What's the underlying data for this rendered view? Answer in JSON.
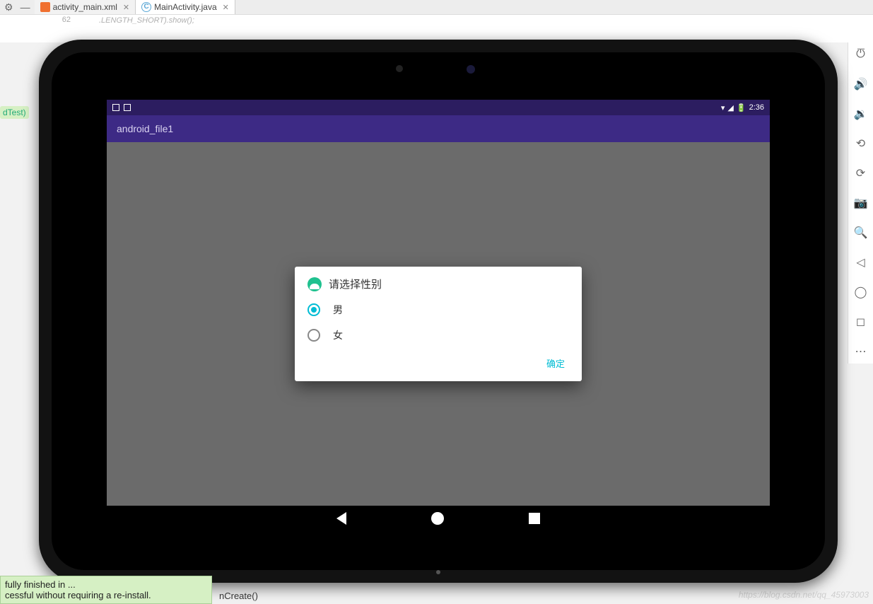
{
  "ide": {
    "tab1": "activity_main.xml",
    "tab2": "MainActivity.java",
    "gutter_line": "62",
    "code_fragment": ".LENGTH_SHORT).show();",
    "dtest": "dTest)",
    "success_line1": "fully finished in ...",
    "success_line2": "cessful without requiring a re-install.",
    "oncreate": "nCreate()"
  },
  "watermark": "https://blog.csdn.net/qq_45973003",
  "statusbar": {
    "time": "2:36"
  },
  "appbar": {
    "title": "android_file1"
  },
  "dialog": {
    "title": "请选择性别",
    "options": [
      "男",
      "女"
    ],
    "selected": 0,
    "confirm": "确定"
  },
  "colors": {
    "status_bg": "#2c1d60",
    "appbar_bg": "#3d2a85",
    "accent": "#00bcd4"
  }
}
